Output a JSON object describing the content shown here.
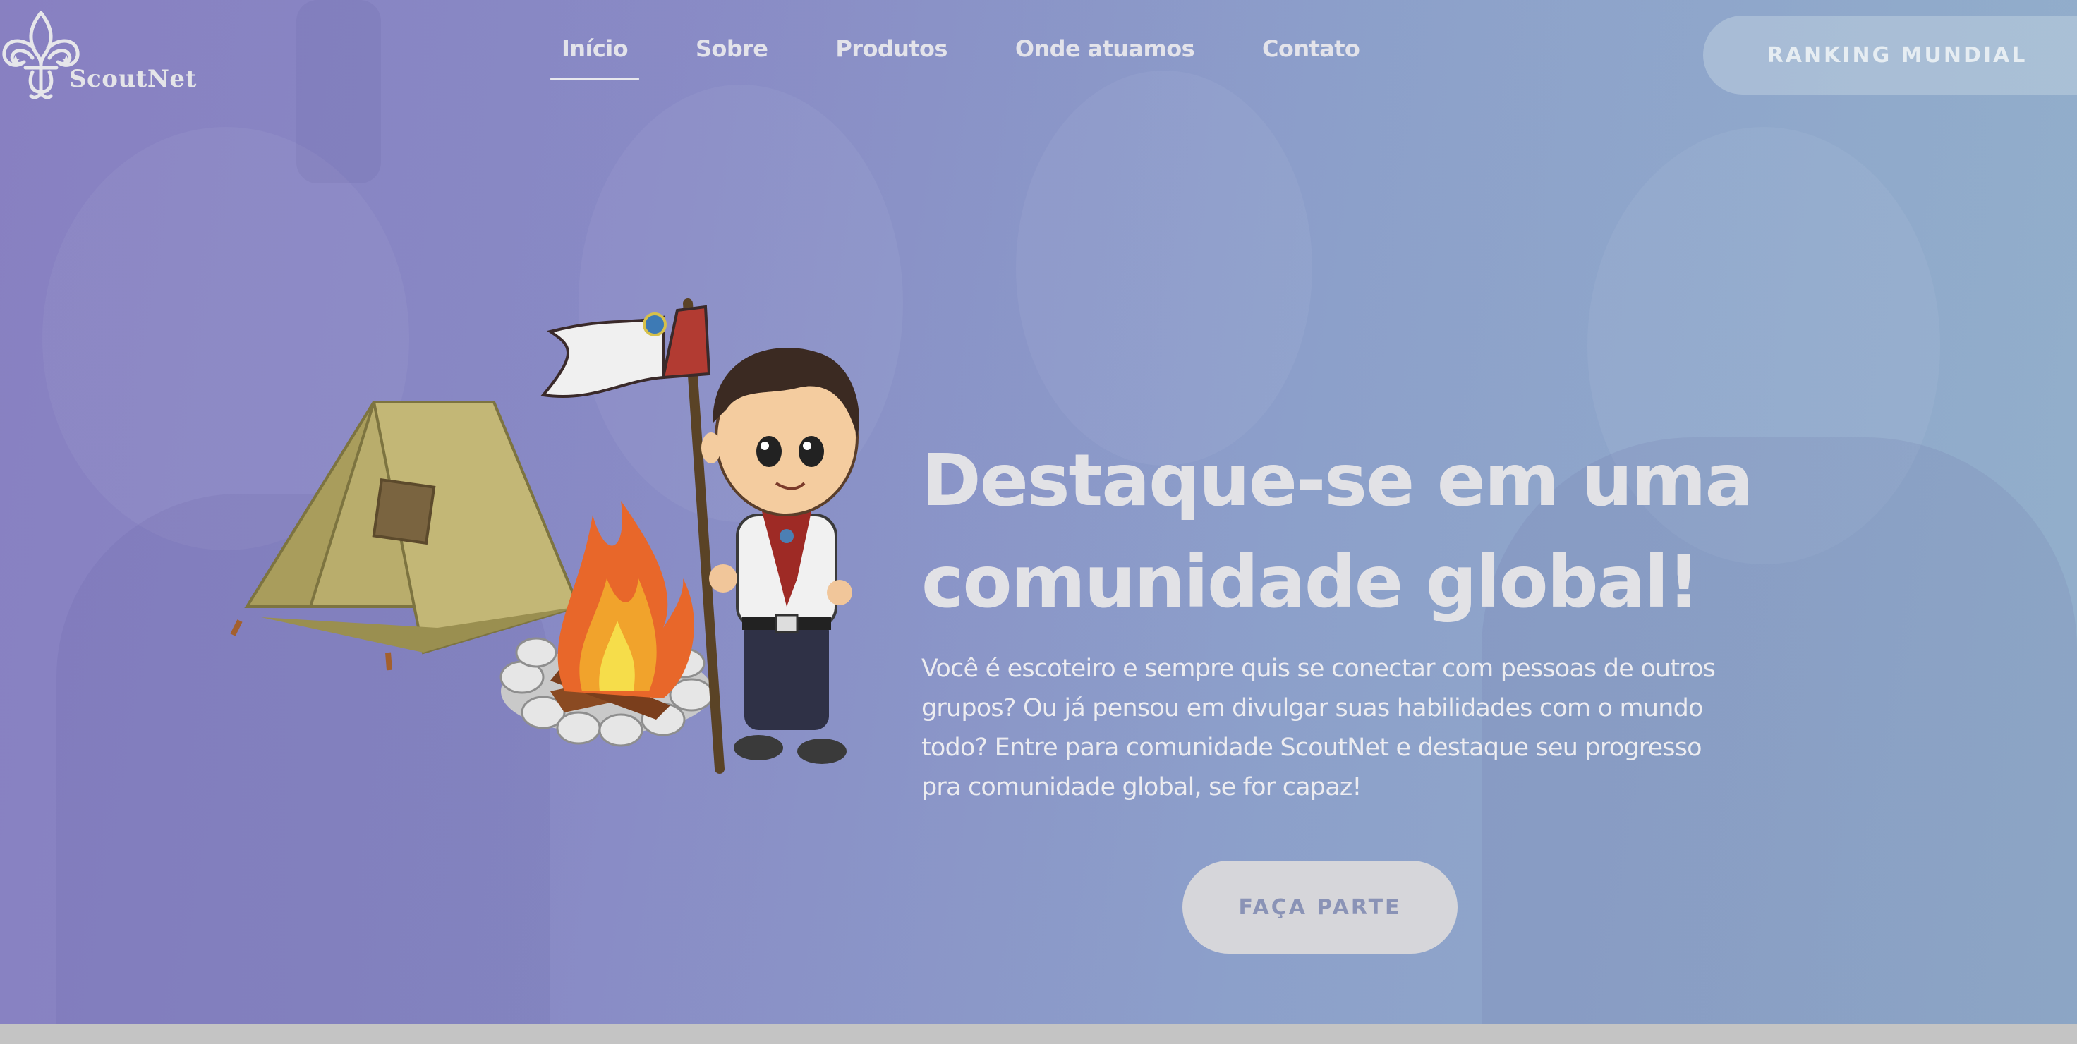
{
  "brand": {
    "name": "ScoutNet"
  },
  "nav": {
    "items": [
      {
        "label": "Início",
        "active": true
      },
      {
        "label": "Sobre",
        "active": false
      },
      {
        "label": "Produtos",
        "active": false
      },
      {
        "label": "Onde atuamos",
        "active": false
      },
      {
        "label": "Contato",
        "active": false
      }
    ],
    "ranking_label": "RANKING MUNDIAL"
  },
  "hero": {
    "headline_line1": "Destaque-se em uma",
    "headline_line2": "comunidade global!",
    "description": "Você é escoteiro e sempre quis se conectar com pessoas de outros grupos? Ou já pensou em divulgar suas habilidades com o mundo todo? Entre para comunidade ScoutNet e destaque seu progresso pra comunidade global, se for capaz!",
    "cta_label": "FAÇA PARTE"
  },
  "icons": {
    "logo": "fleur-de-lis-icon"
  },
  "colors": {
    "hero_gradient_start": "#8b84c2",
    "hero_gradient_end": "#93b0cb",
    "cta_background": "#d6d6da",
    "cta_text": "#8a93b6"
  }
}
